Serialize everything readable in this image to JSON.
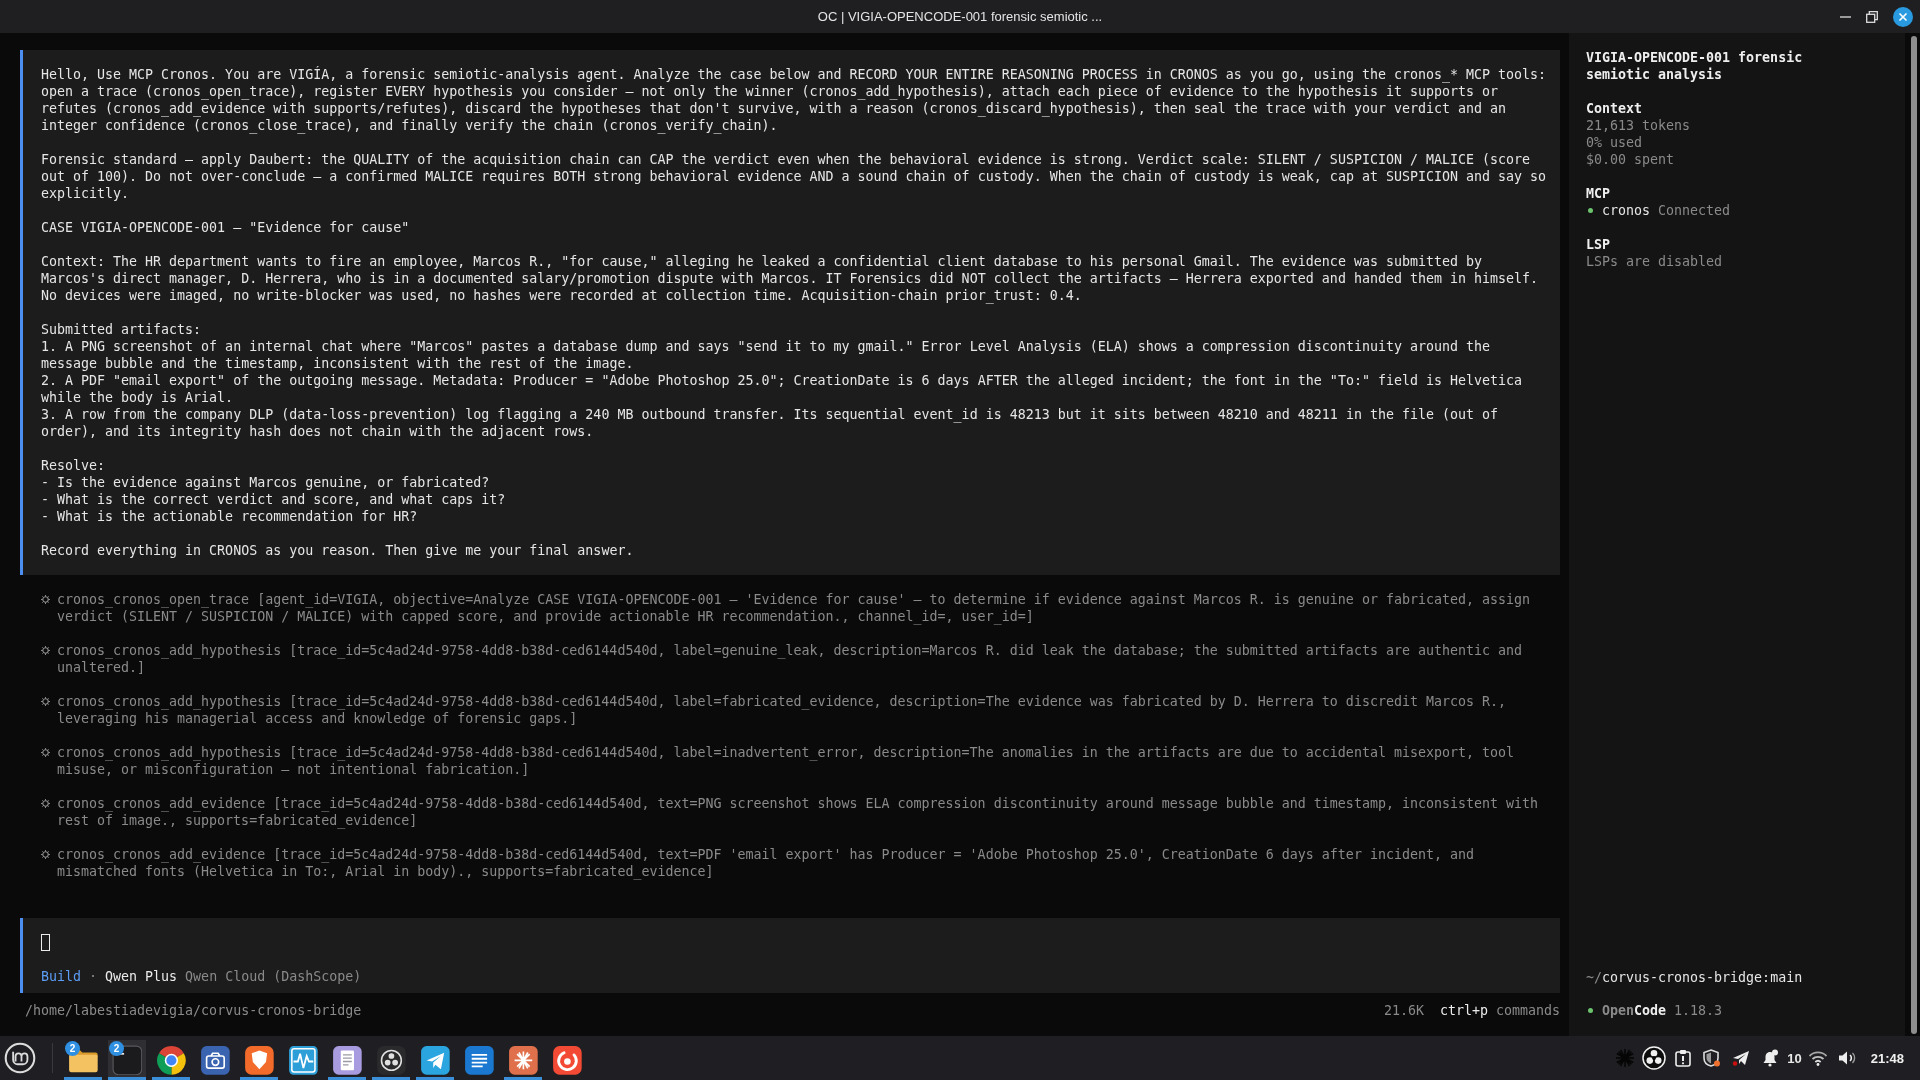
{
  "window": {
    "title": "OC | VIGIA-OPENCODE-001 forensic semiotic ..."
  },
  "prompt": {
    "blocks": [
      [
        "Hello, Use MCP Cronos. You are VIGÍA, a forensic semiotic-analysis agent. Analyze the case below and RECORD YOUR ENTIRE REASONING PROCESS in CRONOS as you go, using the cronos_* MCP tools: open a trace (cronos_open_trace), register EVERY hypothesis you consider — not only the winner (cronos_add_hypothesis), attach each piece of evidence to the hypothesis it supports or refutes (cronos_add_evidence with supports/refutes), discard the hypotheses that don't survive, with a reason (cronos_discard_hypothesis), then seal the trace with your verdict and an integer confidence (cronos_close_trace), and finally verify the chain (cronos_verify_chain)."
      ],
      [
        "Forensic standard — apply Daubert: the QUALITY of the acquisition chain can CAP the verdict even when the behavioral evidence is strong. Verdict scale: SILENT / SUSPICION / MALICE (score out of 100). Do not over-conclude — a confirmed MALICE requires BOTH strong behavioral evidence AND a sound chain of custody. When the chain of custody is weak, cap at SUSPICION and say so explicitly."
      ],
      [
        "CASE VIGIA-OPENCODE-001 — \"Evidence for cause\""
      ],
      [
        "Context: The HR department wants to fire an employee, Marcos R., \"for cause,\" alleging he leaked a confidential client database to his personal Gmail. The evidence was submitted by Marcos's direct manager, D. Herrera, who is in a documented salary/promotion dispute with Marcos. IT Forensics did NOT collect the artifacts — Herrera exported and handed them in himself. No devices were imaged, no write-blocker was used, no hashes were recorded at collection time. Acquisition-chain prior_trust: 0.4."
      ],
      [
        "Submitted artifacts:",
        "1. A PNG screenshot of an internal chat where \"Marcos\" pastes a database dump and says \"send it to my gmail.\" Error Level Analysis (ELA) shows a compression discontinuity around the message bubble and the timestamp, inconsistent with the rest of the image.",
        "2. A PDF \"email export\" of the outgoing message. Metadata: Producer = \"Adobe Photoshop 25.0\"; CreationDate is 6 days AFTER the alleged incident; the font in the \"To:\" field is Helvetica while the body is Arial.",
        "3. A row from the company DLP (data-loss-prevention) log flagging a 240 MB outbound transfer. Its sequential event_id is 48213 but it sits between 48210 and 48211 in the file (out of order), and its integrity hash does not chain with the adjacent rows."
      ],
      [
        "Resolve:",
        "- Is the evidence against Marcos genuine, or fabricated?",
        "- What is the correct verdict and score, and what caps it?",
        "- What is the actionable recommendation for HR?"
      ],
      [
        "Record everything in CRONOS as you reason. Then give me your final answer."
      ]
    ]
  },
  "tool_calls": [
    {
      "text": "cronos_cronos_open_trace [agent_id=VIGIA, objective=Analyze CASE VIGIA-OPENCODE-001 — 'Evidence for cause' — to determine if evidence against Marcos R. is genuine or fabricated, assign verdict (SILENT / SUSPICION / MALICE) with capped score, and provide actionable HR recommendation., channel_id=, user_id=]"
    },
    {
      "text": "cronos_cronos_add_hypothesis [trace_id=5c4ad24d-9758-4dd8-b38d-ced6144d540d, label=genuine_leak, description=Marcos R. did leak the database; the submitted artifacts are authentic and unaltered.]"
    },
    {
      "text": "cronos_cronos_add_hypothesis [trace_id=5c4ad24d-9758-4dd8-b38d-ced6144d540d, label=fabricated_evidence, description=The evidence was fabricated by D. Herrera to discredit Marcos R., leveraging his managerial access and knowledge of forensic gaps.]"
    },
    {
      "text": "cronos_cronos_add_hypothesis [trace_id=5c4ad24d-9758-4dd8-b38d-ced6144d540d, label=inadvertent_error, description=The anomalies in the artifacts are due to accidental misexport, tool misuse, or misconfiguration — not intentional fabrication.]"
    },
    {
      "text": "cronos_cronos_add_evidence [trace_id=5c4ad24d-9758-4dd8-b38d-ced6144d540d, text=PNG screenshot shows ELA compression discontinuity around message bubble and timestamp, inconsistent with rest of image., supports=fabricated_evidence]"
    },
    {
      "text": "cronos_cronos_add_evidence [trace_id=5c4ad24d-9758-4dd8-b38d-ced6144d540d, text=PDF 'email export' has Producer = 'Adobe Photoshop 25.0', CreationDate 6 days after incident, and mismatched fonts (Helvetica in To:, Arial in body)., supports=fabricated_evidence]"
    }
  ],
  "input": {
    "focused": true
  },
  "agent": {
    "mode": "Build",
    "separator": "·",
    "model": "Qwen Plus",
    "provider": "Qwen Cloud (DashScope)"
  },
  "status_bar": {
    "path": "/home/labestiadevigia/corvus-cronos-bridge",
    "tokens": "21.6K",
    "shortcut": "ctrl+p",
    "shortcut_label": "commands"
  },
  "sidebar": {
    "title": "VIGIA-OPENCODE-001 forensic semiotic analysis",
    "sections": [
      {
        "kind": "lines",
        "heading": "Context",
        "lines": [
          "21,613 tokens",
          "0% used",
          "$0.00 spent"
        ]
      },
      {
        "kind": "servers",
        "heading": "MCP",
        "servers": [
          {
            "name": "cronos",
            "status": "Connected",
            "color": "#6cc46e"
          }
        ]
      },
      {
        "kind": "lines",
        "heading": "LSP",
        "lines": [
          "LSPs are disabled"
        ]
      }
    ],
    "branch": {
      "prefix": "~/",
      "name": "corvus-cronos-bridge:main"
    },
    "app": {
      "name_dim": "Open",
      "name_bright": "Code",
      "version": "1.18.3"
    }
  },
  "taskbar": {
    "apps": [
      {
        "kind": "folder",
        "badge": "2",
        "running": true,
        "active": false
      },
      {
        "kind": "terminal",
        "badge": "2",
        "running": true,
        "active": true
      },
      {
        "kind": "browser",
        "running": true,
        "active": false
      },
      {
        "kind": "camera",
        "running": false,
        "active": false
      },
      {
        "kind": "shield",
        "running": true,
        "active": false
      },
      {
        "kind": "monitor",
        "running": false,
        "active": false
      },
      {
        "kind": "editor",
        "running": true,
        "active": false
      },
      {
        "kind": "recorder",
        "running": true,
        "active": false
      },
      {
        "kind": "messenger",
        "running": true,
        "active": false
      },
      {
        "kind": "notes",
        "running": false,
        "active": false
      },
      {
        "kind": "starburst",
        "running": true,
        "active": false
      },
      {
        "kind": "swirl",
        "running": false,
        "active": false
      }
    ],
    "tray": [
      {
        "kind": "starburst"
      },
      {
        "kind": "recorder"
      },
      {
        "kind": "clipboard"
      },
      {
        "kind": "shield"
      },
      {
        "kind": "messenger"
      },
      {
        "kind": "notifications",
        "count": "10"
      },
      {
        "kind": "wifi"
      },
      {
        "kind": "volume"
      }
    ],
    "clock": "21:48"
  }
}
